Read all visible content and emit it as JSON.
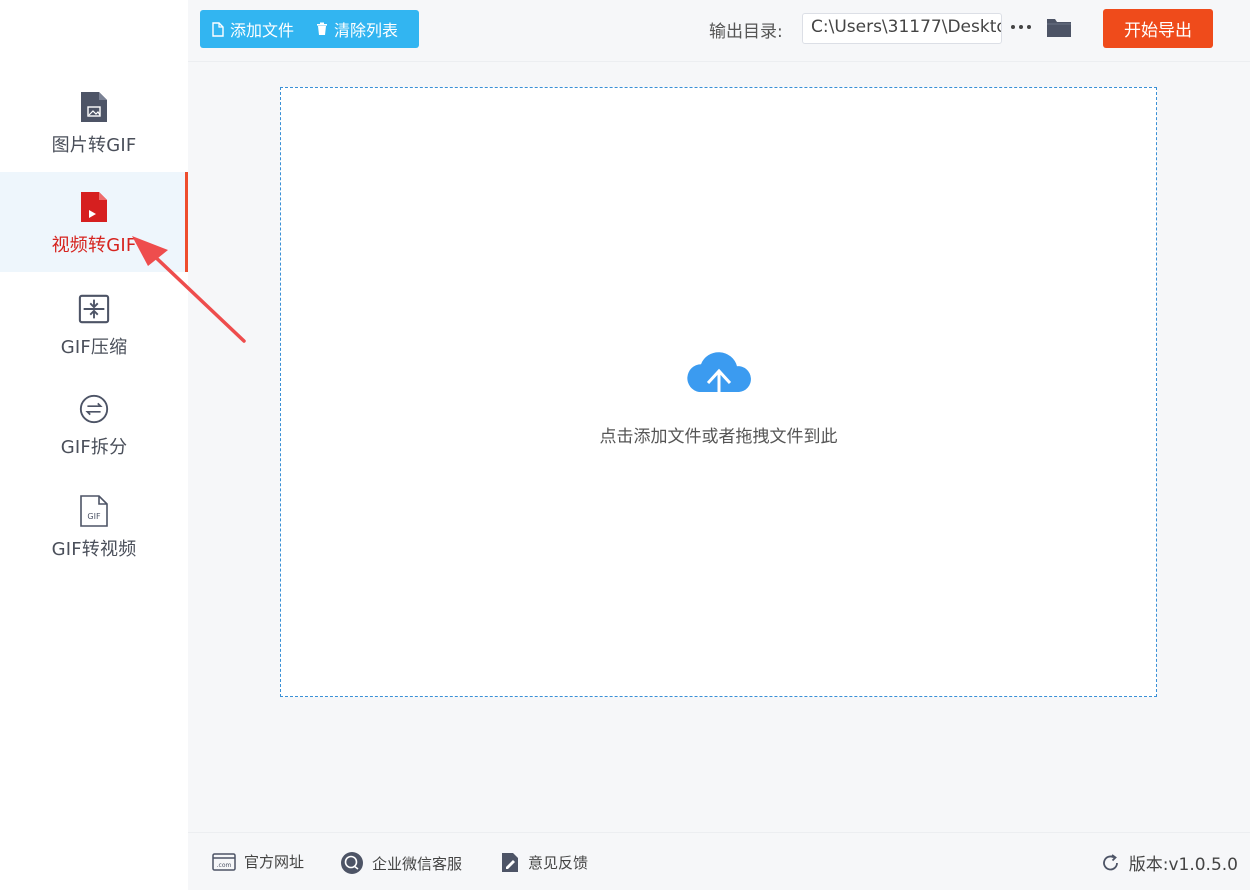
{
  "sidebar": {
    "items": [
      {
        "label": "图片转GIF",
        "icon": "image-file-icon",
        "active": false
      },
      {
        "label": "视频转GIF",
        "icon": "video-file-icon",
        "active": true
      },
      {
        "label": "GIF压缩",
        "icon": "compress-icon",
        "active": false
      },
      {
        "label": "GIF拆分",
        "icon": "split-icon",
        "active": false
      },
      {
        "label": "GIF转视频",
        "icon": "gif-file-icon",
        "active": false
      }
    ]
  },
  "toolbar": {
    "add_file_label": "添加文件",
    "clear_list_label": "清除列表",
    "output_dir_label": "输出目录:",
    "output_dir_value": "C:\\Users\\31177\\Deskto",
    "more_label": "···",
    "start_label": "开始导出"
  },
  "dropzone": {
    "hint": "点击添加文件或者拖拽文件到此"
  },
  "footer": {
    "website_label": "官方网址",
    "wechat_label": "企业微信客服",
    "feedback_label": "意见反馈",
    "version_label": "版本:v1.0.5.0"
  },
  "colors": {
    "accent_blue": "#32b5f1",
    "start_red": "#ef4b1b",
    "active_red": "#d6241f",
    "dropzone_border": "#3a90d6",
    "annotation_arrow": "#ee4d4d"
  }
}
